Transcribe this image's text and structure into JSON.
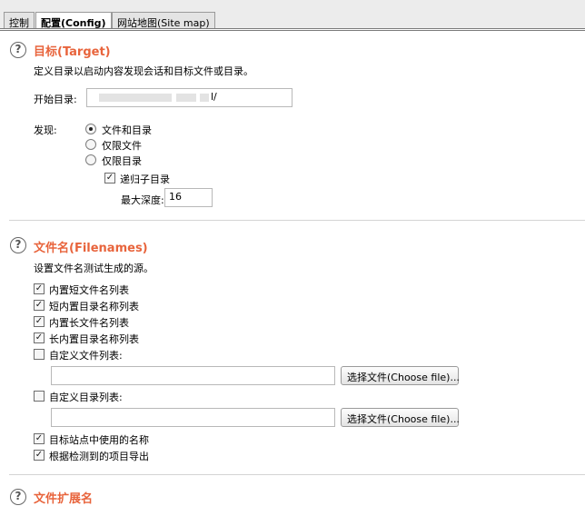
{
  "tabs": [
    {
      "label": "控制"
    },
    {
      "label": "配置(Config)"
    },
    {
      "label": "网站地图(Site map)"
    }
  ],
  "help_glyph": "?",
  "target": {
    "title": "目标(Target)",
    "description": "定义目录以启动内容发现会话和目标文件或目录。",
    "start_dir_label": "开始目录:",
    "start_dir_value": "l/",
    "discover_label": "发现:",
    "radios": [
      {
        "label": "文件和目录",
        "checked": true
      },
      {
        "label": "仅限文件",
        "checked": false
      },
      {
        "label": "仅限目录",
        "checked": false
      }
    ],
    "recursive_label": "递归子目录",
    "recursive_checked": true,
    "max_depth_label": "最大深度:",
    "max_depth_value": "16"
  },
  "filenames": {
    "title": "文件名(Filenames)",
    "description": "设置文件名测试生成的源。",
    "items": [
      {
        "label": "内置短文件名列表",
        "checked": true
      },
      {
        "label": "短内置目录名称列表",
        "checked": true
      },
      {
        "label": "内置长文件名列表",
        "checked": true
      },
      {
        "label": "长内置目录名称列表",
        "checked": true
      }
    ],
    "custom_file_label": "自定义文件列表:",
    "custom_file_checked": false,
    "custom_file_value": "",
    "custom_dir_label": "自定义目录列表:",
    "custom_dir_checked": false,
    "custom_dir_value": "",
    "choose_file_label": "选择文件(Choose file)...",
    "site_names_label": "目标站点中使用的名称",
    "site_names_checked": true,
    "derived_label": "根据检测到的项目导出",
    "derived_checked": true
  },
  "next_section": {
    "title": "文件扩展名"
  },
  "colors": {
    "section_title": "#e8643c",
    "background": "#ffffff",
    "tabbar": "#ececec"
  }
}
